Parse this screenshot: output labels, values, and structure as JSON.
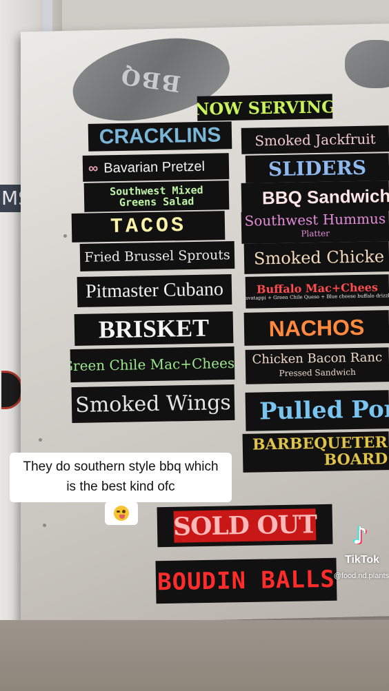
{
  "background_sign": "MS",
  "pig_sign": "BBQ",
  "menu_left": {
    "now_serving": "NOW SERVING",
    "cracklins": "CRACKLINS",
    "pretzel": "Bavarian Pretzel",
    "southwest_line1": "Southwest Mixed",
    "southwest_line2": "Greens Salad",
    "tacos": "TACOS",
    "fried_brussel": "Fried Brussel Sprouts",
    "pitmaster": "Pitmaster Cubano",
    "brisket": "BRISKET",
    "green_chile": "Green Chile Mac+Cheese",
    "smoked_wings": "Smoked Wings"
  },
  "menu_right": {
    "jackfruit": "Smoked Jackfruit",
    "sliders": "SLIDERS",
    "bbq_sandwich": "BBQ Sandwich",
    "hummus": "Southwest Hummus",
    "hummus_sub": "Platter",
    "smoked_chicken": "Smoked Chicke",
    "buffalo": "Buffalo Mac+Chees",
    "buffalo_sub": "cavatappi + Green Chile Queso + Blue cheese buffalo drizzle",
    "nachos": "NACHOS",
    "chicken_bacon": "Chicken Bacon Ranc",
    "chicken_bacon_sub": "Pressed Sandwich",
    "pulled_pork": "Pulled Por",
    "barbequeter": "BARBEQUETER",
    "barbequeter_sub": "BOARD"
  },
  "bottom_signs": {
    "sold_out": "SOLD OUT",
    "boudin": "BOUDIN BALLS"
  },
  "caption": {
    "line": "They do southern style bbq which is the best kind ofc",
    "emoji": "winking-face-tongue"
  },
  "tiktok": {
    "brand": "TikTok",
    "handle": "@food.nd.plants"
  }
}
